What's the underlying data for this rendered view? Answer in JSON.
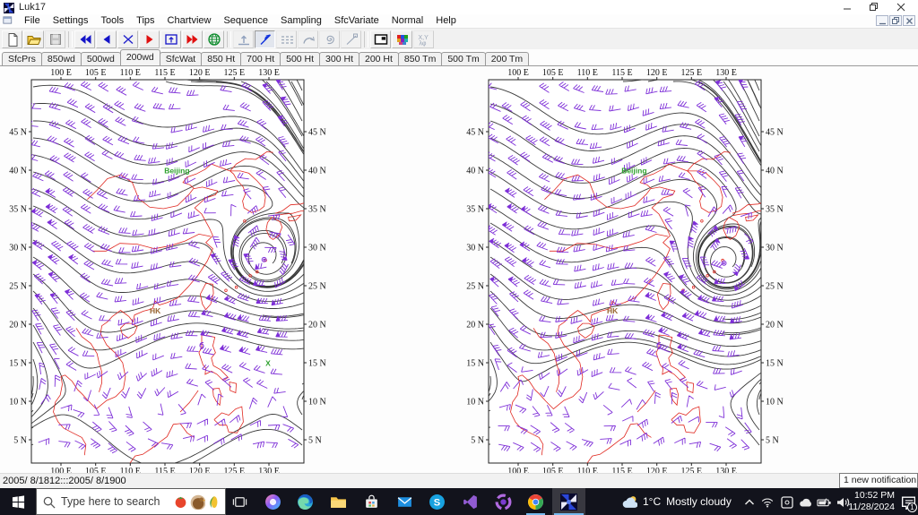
{
  "window": {
    "title": "Luk17"
  },
  "menu_bar": {
    "items": [
      "File",
      "Settings",
      "Tools",
      "Tips",
      "Chartview",
      "Sequence",
      "Sampling",
      "SfcVariate",
      "Normal",
      "Help"
    ]
  },
  "toolbar": {
    "buttons": [
      {
        "icon": "new-document",
        "state": "normal"
      },
      {
        "icon": "open-file",
        "state": "normal"
      },
      {
        "icon": "save-file",
        "state": "disabled"
      },
      {
        "icon": "go-first",
        "state": "normal",
        "sep_before": true
      },
      {
        "icon": "go-previous",
        "state": "normal"
      },
      {
        "icon": "cancel-x",
        "state": "normal"
      },
      {
        "icon": "go-next",
        "state": "normal"
      },
      {
        "icon": "fit-frame",
        "state": "normal"
      },
      {
        "icon": "go-last",
        "state": "normal"
      },
      {
        "icon": "globe",
        "state": "normal"
      },
      {
        "icon": "ascent-profile",
        "state": "disabled",
        "sep_before": true
      },
      {
        "icon": "wind-barb",
        "state": "pressed"
      },
      {
        "icon": "dashed-lines",
        "state": "disabled"
      },
      {
        "icon": "curve-arrow",
        "state": "disabled"
      },
      {
        "icon": "spiral",
        "state": "disabled"
      },
      {
        "icon": "node-line",
        "state": "disabled"
      },
      {
        "icon": "dual-panel",
        "state": "normal",
        "sep_before": true
      },
      {
        "icon": "color-grid",
        "state": "normal"
      },
      {
        "icon": "char-codes",
        "state": "disabled"
      }
    ]
  },
  "tab_bar": {
    "tabs": [
      "SfcPrs",
      "850wd",
      "500wd",
      "200wd",
      "SfcWat",
      "850 Ht",
      "700 Ht",
      "500 Ht",
      "300 Ht",
      "200 Ht",
      "850 Tm",
      "500 Tm",
      "200 Tm"
    ],
    "active_index": 3
  },
  "charts": {
    "lon_ticks": [
      "100 E",
      "105 E",
      "110 E",
      "115 E",
      "120 E",
      "125 E",
      "130 E"
    ],
    "lat_ticks": [
      "45 N",
      "40 N",
      "35 N",
      "30 N",
      "25 N",
      "20 N",
      "15 N",
      "10 N",
      "5 N"
    ],
    "labels": {
      "city": "Beijing",
      "hk": "HK",
      "x_marker": "X"
    },
    "label_pos": {
      "city": [
        114.9,
        39.6
      ],
      "hk": [
        112.8,
        21.4
      ],
      "x_marker": [
        129.5,
        14.6
      ],
      "vortex": [
        129.3,
        28.4
      ],
      "storm": [
        120.3,
        17.2
      ]
    },
    "colors": {
      "contour": "#3a3a3a",
      "wind_barb": "#7e2fd8",
      "coastline": "#e02820",
      "city_label": "#2fa12f",
      "hk_label": "#996633",
      "x_marker": "#2fa12f"
    },
    "panels": [
      {
        "name": "chart-left",
        "x_marker": true,
        "phase": 0,
        "seed": 7
      },
      {
        "name": "chart-right",
        "x_marker": false,
        "phase": 1,
        "seed": 13
      }
    ],
    "geo": {
      "china_coast": [
        [
          124.4,
          39.9
        ],
        [
          122.9,
          40.4
        ],
        [
          121.7,
          40.8
        ],
        [
          120.8,
          40.1
        ],
        [
          119.5,
          39.5
        ],
        [
          118.2,
          39.1
        ],
        [
          117.6,
          38.4
        ],
        [
          118.6,
          38.1
        ],
        [
          119.2,
          37.6
        ],
        [
          120.4,
          37.8
        ],
        [
          121.7,
          37.5
        ],
        [
          122.6,
          37.3
        ],
        [
          122.3,
          36.8
        ],
        [
          120.9,
          36.4
        ],
        [
          119.3,
          35.1
        ],
        [
          120.3,
          34.3
        ],
        [
          121.4,
          32.5
        ],
        [
          121.9,
          31.5
        ],
        [
          120.9,
          30.6
        ],
        [
          121.9,
          29.8
        ],
        [
          121.1,
          28.2
        ],
        [
          119.8,
          26.4
        ],
        [
          118.3,
          24.8
        ],
        [
          116.8,
          23.4
        ],
        [
          115.3,
          22.8
        ],
        [
          114.2,
          22.5
        ],
        [
          113.6,
          23.0
        ],
        [
          113.2,
          22.0
        ],
        [
          111.9,
          21.7
        ],
        [
          110.6,
          21.2
        ],
        [
          110.4,
          20.3
        ],
        [
          109.8,
          21.0
        ],
        [
          108.6,
          21.8
        ],
        [
          107.4,
          21.0
        ],
        [
          106.7,
          20.3
        ],
        [
          105.9,
          19.8
        ],
        [
          105.7,
          18.8
        ],
        [
          106.6,
          17.3
        ],
        [
          107.9,
          16.2
        ],
        [
          108.9,
          15.0
        ],
        [
          109.3,
          13.2
        ],
        [
          109.0,
          11.6
        ],
        [
          107.9,
          10.6
        ],
        [
          106.6,
          10.1
        ],
        [
          105.1,
          9.0
        ],
        [
          104.0,
          10.0
        ],
        [
          103.1,
          10.9
        ],
        [
          102.4,
          11.5
        ],
        [
          101.6,
          12.6
        ],
        [
          100.6,
          13.4
        ],
        [
          100.0,
          13.2
        ],
        [
          100.2,
          12.2
        ],
        [
          99.9,
          10.8
        ],
        [
          99.2,
          9.9
        ],
        [
          98.9,
          8.6
        ],
        [
          99.6,
          7.3
        ],
        [
          100.4,
          6.5
        ],
        [
          101.7,
          5.9
        ],
        [
          103.0,
          5.3
        ],
        [
          103.6,
          4.4
        ],
        [
          103.4,
          3.0
        ]
      ],
      "korea": [
        [
          124.4,
          39.9
        ],
        [
          124.9,
          39.5
        ],
        [
          125.4,
          38.7
        ],
        [
          126.3,
          37.8
        ],
        [
          126.6,
          36.9
        ],
        [
          126.2,
          36.0
        ],
        [
          126.4,
          35.1
        ],
        [
          127.5,
          34.5
        ],
        [
          128.6,
          34.8
        ],
        [
          129.3,
          35.3
        ],
        [
          129.5,
          36.5
        ],
        [
          129.1,
          37.8
        ],
        [
          128.3,
          38.6
        ],
        [
          127.1,
          39.6
        ],
        [
          125.9,
          39.9
        ],
        [
          124.4,
          39.9
        ]
      ],
      "nk_border": [
        [
          124.4,
          39.9
        ],
        [
          125.3,
          40.8
        ],
        [
          126.6,
          41.5
        ],
        [
          128.1,
          41.4
        ],
        [
          129.7,
          42.4
        ],
        [
          130.6,
          42.3
        ]
      ],
      "kyushu": [
        [
          130.1,
          31.3
        ],
        [
          129.6,
          32.3
        ],
        [
          129.8,
          33.2
        ],
        [
          130.4,
          33.9
        ],
        [
          131.0,
          33.6
        ],
        [
          131.6,
          33.3
        ],
        [
          131.9,
          32.6
        ],
        [
          131.4,
          31.5
        ],
        [
          130.6,
          31.0
        ],
        [
          130.1,
          31.3
        ]
      ],
      "honshu_s": [
        [
          130.9,
          34.1
        ],
        [
          132.2,
          34.3
        ],
        [
          133.4,
          34.4
        ],
        [
          134.6,
          34.7
        ],
        [
          135.6,
          34.7
        ]
      ],
      "honshu_n": [
        [
          130.9,
          34.4
        ],
        [
          131.9,
          34.7
        ],
        [
          133.1,
          35.5
        ],
        [
          134.6,
          35.6
        ],
        [
          135.6,
          35.9
        ]
      ],
      "shikoku": [
        [
          132.9,
          33.4
        ],
        [
          133.9,
          33.5
        ],
        [
          134.6,
          34.2
        ],
        [
          133.6,
          34.0
        ],
        [
          132.8,
          33.9
        ],
        [
          132.9,
          33.4
        ]
      ],
      "taiwan": [
        [
          121.9,
          25.2
        ],
        [
          120.9,
          25.3
        ],
        [
          120.1,
          23.9
        ],
        [
          120.4,
          22.6
        ],
        [
          120.9,
          21.9
        ],
        [
          121.6,
          22.6
        ],
        [
          122.0,
          24.0
        ],
        [
          121.9,
          25.2
        ]
      ],
      "hainan": [
        [
          109.3,
          20.1
        ],
        [
          108.6,
          19.5
        ],
        [
          108.8,
          18.8
        ],
        [
          109.7,
          18.2
        ],
        [
          110.6,
          18.8
        ],
        [
          111.0,
          19.7
        ],
        [
          110.2,
          20.1
        ],
        [
          109.3,
          20.1
        ]
      ],
      "luzon": [
        [
          120.3,
          18.6
        ],
        [
          121.3,
          18.5
        ],
        [
          122.2,
          18.3
        ],
        [
          121.9,
          17.2
        ],
        [
          122.3,
          16.3
        ],
        [
          121.7,
          15.6
        ],
        [
          122.0,
          14.6
        ],
        [
          123.0,
          14.1
        ],
        [
          124.1,
          13.1
        ],
        [
          123.4,
          12.7
        ],
        [
          122.5,
          13.5
        ],
        [
          121.7,
          13.9
        ],
        [
          120.8,
          13.5
        ],
        [
          120.9,
          14.3
        ],
        [
          120.5,
          14.7
        ],
        [
          119.9,
          16.3
        ],
        [
          120.3,
          17.0
        ],
        [
          120.3,
          18.6
        ]
      ],
      "samar": [
        [
          124.3,
          12.5
        ],
        [
          125.3,
          12.3
        ],
        [
          125.2,
          11.1
        ],
        [
          124.4,
          11.4
        ],
        [
          124.3,
          12.5
        ]
      ],
      "negros": [
        [
          121.9,
          11.6
        ],
        [
          122.8,
          11.7
        ],
        [
          123.1,
          10.9
        ],
        [
          122.9,
          9.5
        ],
        [
          122.4,
          10.0
        ],
        [
          122.0,
          10.7
        ],
        [
          121.9,
          11.6
        ]
      ],
      "mindanao": [
        [
          122.1,
          7.6
        ],
        [
          123.2,
          8.5
        ],
        [
          124.2,
          8.2
        ],
        [
          125.2,
          9.0
        ],
        [
          126.1,
          9.3
        ],
        [
          126.3,
          7.3
        ],
        [
          125.4,
          5.9
        ],
        [
          124.2,
          6.0
        ],
        [
          123.9,
          6.9
        ],
        [
          122.9,
          6.9
        ],
        [
          122.1,
          7.6
        ]
      ],
      "palawan": [
        [
          117.2,
          8.6
        ],
        [
          118.5,
          9.8
        ],
        [
          119.4,
          10.9
        ],
        [
          119.8,
          11.4
        ]
      ],
      "borneo": [
        [
          109.9,
          1.9
        ],
        [
          110.7,
          2.9
        ],
        [
          111.8,
          3.1
        ],
        [
          113.1,
          3.9
        ],
        [
          114.4,
          4.8
        ],
        [
          115.3,
          5.4
        ],
        [
          116.2,
          7.0
        ],
        [
          117.2,
          7.1
        ],
        [
          118.2,
          5.9
        ],
        [
          119.2,
          5.3
        ]
      ],
      "yangtze_river": [
        [
          104.5,
          29.5
        ],
        [
          106.5,
          29.5
        ],
        [
          108.5,
          30.5
        ],
        [
          111.0,
          30.4
        ],
        [
          113.5,
          29.8
        ],
        [
          115.8,
          30.2
        ],
        [
          117.9,
          30.8
        ],
        [
          119.9,
          31.7
        ],
        [
          121.6,
          31.4
        ]
      ],
      "yellow_river": [
        [
          103.8,
          36.2
        ],
        [
          105.2,
          37.4
        ],
        [
          106.7,
          38.9
        ],
        [
          108.6,
          39.4
        ],
        [
          110.3,
          38.4
        ],
        [
          111.2,
          36.3
        ],
        [
          112.8,
          35.2
        ],
        [
          114.8,
          35.0
        ],
        [
          116.8,
          35.4
        ],
        [
          118.5,
          36.9
        ],
        [
          119.1,
          37.6
        ]
      ],
      "mekong": [
        [
          102.2,
          19.5
        ],
        [
          103.0,
          18.4
        ],
        [
          104.3,
          17.5
        ],
        [
          105.2,
          16.2
        ],
        [
          105.5,
          15.0
        ],
        [
          105.9,
          13.8
        ],
        [
          105.9,
          12.4
        ],
        [
          105.5,
          11.2
        ]
      ],
      "island_dots": [
        [
          123.8,
          24.4
        ],
        [
          125.3,
          24.8
        ],
        [
          127.3,
          26.3
        ],
        [
          128.3,
          26.8
        ],
        [
          129.5,
          28.3
        ],
        [
          126.5,
          33.4
        ]
      ]
    }
  },
  "status_bar": {
    "text": "2005/ 8/1812:::2005/ 8/1900"
  },
  "notification_popup": {
    "text": "1 new notification"
  },
  "taskbar": {
    "search": {
      "placeholder": "Type here to search"
    },
    "apps": [
      {
        "name": "task-view"
      },
      {
        "name": "copilot"
      },
      {
        "name": "edge"
      },
      {
        "name": "file-explorer"
      },
      {
        "name": "store"
      },
      {
        "name": "mail"
      },
      {
        "name": "skype"
      },
      {
        "name": "visual-studio"
      },
      {
        "name": "vs-installer"
      },
      {
        "name": "chrome",
        "running": true
      },
      {
        "name": "luk17",
        "active": true
      }
    ],
    "weather": {
      "temperature": "1°C",
      "condition": "Mostly cloudy"
    },
    "tray_icons": [
      "chevron-up",
      "wifi",
      "device",
      "onedrive",
      "battery",
      "volume"
    ],
    "clock": {
      "time": "10:52 PM",
      "date": "11/28/2024"
    },
    "notifications": {
      "count": "1"
    }
  }
}
